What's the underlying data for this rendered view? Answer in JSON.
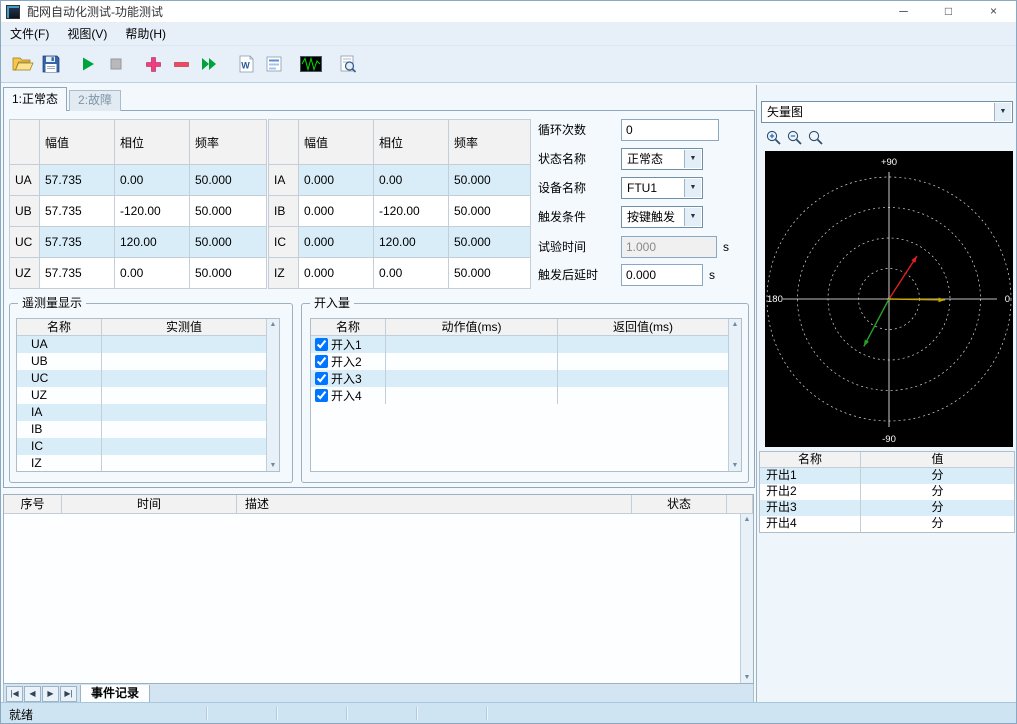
{
  "window": {
    "title": "配网自动化测试-功能测试",
    "minimize_glyph": "─",
    "maximize_glyph": "□",
    "close_glyph": "×"
  },
  "menu": {
    "file": "文件(F)",
    "view": "视图(V)",
    "help": "帮助(H)"
  },
  "toolbar": {
    "icons": [
      "open",
      "save",
      "start",
      "stop",
      "add-state",
      "remove-state",
      "run-all",
      "word-report",
      "report-view",
      "waveform-view",
      "preview"
    ]
  },
  "icons": {
    "dropdown_arrow": "▼",
    "scroll_up": "▲",
    "scroll_down": "▼"
  },
  "tabs": {
    "normal": "1:正常态",
    "fault": "2:故障"
  },
  "voltage_table": {
    "headers": {
      "amp": "幅值",
      "phase": "相位",
      "freq": "频率"
    },
    "rows": [
      {
        "name": "UA",
        "amp": "57.735",
        "phase": "0.00",
        "freq": "50.000"
      },
      {
        "name": "UB",
        "amp": "57.735",
        "phase": "-120.00",
        "freq": "50.000"
      },
      {
        "name": "UC",
        "amp": "57.735",
        "phase": "120.00",
        "freq": "50.000"
      },
      {
        "name": "UZ",
        "amp": "57.735",
        "phase": "0.00",
        "freq": "50.000"
      }
    ]
  },
  "current_table": {
    "headers": {
      "amp": "幅值",
      "phase": "相位",
      "freq": "频率"
    },
    "rows": [
      {
        "name": "IA",
        "amp": "0.000",
        "phase": "0.00",
        "freq": "50.000"
      },
      {
        "name": "IB",
        "amp": "0.000",
        "phase": "-120.00",
        "freq": "50.000"
      },
      {
        "name": "IC",
        "amp": "0.000",
        "phase": "120.00",
        "freq": "50.000"
      },
      {
        "name": "IZ",
        "amp": "0.000",
        "phase": "0.00",
        "freq": "50.000"
      }
    ]
  },
  "settings": {
    "cycle_label": "循环次数",
    "cycle_value": "0",
    "state_label": "状态名称",
    "state_value": "正常态",
    "device_label": "设备名称",
    "device_value": "FTU1",
    "trigger_label": "触发条件",
    "trigger_value": "按键触发",
    "testtime_label": "试验时间",
    "testtime_value": "1.000",
    "testtime_unit": "s",
    "delay_label": "触发后延时",
    "delay_value": "0.000",
    "delay_unit": "s"
  },
  "telemetry": {
    "title": "遥测量显示",
    "name_header": "名称",
    "value_header": "实测值",
    "rows": [
      {
        "name": "UA",
        "value": ""
      },
      {
        "name": "UB",
        "value": ""
      },
      {
        "name": "UC",
        "value": ""
      },
      {
        "name": "UZ",
        "value": ""
      },
      {
        "name": "IA",
        "value": ""
      },
      {
        "name": "IB",
        "value": ""
      },
      {
        "name": "IC",
        "value": ""
      },
      {
        "name": "IZ",
        "value": ""
      }
    ]
  },
  "digital_inputs": {
    "title": "开入量",
    "name_header": "名称",
    "action_header": "动作值(ms)",
    "return_header": "返回值(ms)",
    "rows": [
      {
        "name": "开入1",
        "checked": "checked"
      },
      {
        "name": "开入2",
        "checked": "checked"
      },
      {
        "name": "开入3",
        "checked": "checked"
      },
      {
        "name": "开入4",
        "checked": "checked"
      }
    ]
  },
  "events": {
    "headers": {
      "index": "序号",
      "time": "时间",
      "desc": "描述",
      "status": "状态"
    },
    "nav": [
      "|◀",
      "◀",
      "▶",
      "▶|"
    ],
    "tab": "事件记录"
  },
  "statusbar": {
    "ready": "就绪"
  },
  "vector_panel": {
    "selector": "矢量图",
    "labels": {
      "top": "+90",
      "left": "180",
      "right": "0",
      "bottom": "-90"
    },
    "arrows": [
      {
        "name": "vector-red",
        "color": "#e02020",
        "angle_deg": 57,
        "length_ratio": 0.42
      },
      {
        "name": "vector-yellow",
        "color": "#c8a800",
        "angle_deg": -1,
        "length_ratio": 0.46
      },
      {
        "name": "vector-green",
        "color": "#28a028",
        "angle_deg": 242,
        "length_ratio": 0.44
      }
    ],
    "outputs": {
      "name_header": "名称",
      "value_header": "值",
      "rows": [
        {
          "name": "开出1",
          "value": "分"
        },
        {
          "name": "开出2",
          "value": "分"
        },
        {
          "name": "开出3",
          "value": "分"
        },
        {
          "name": "开出4",
          "value": "分"
        }
      ]
    }
  }
}
